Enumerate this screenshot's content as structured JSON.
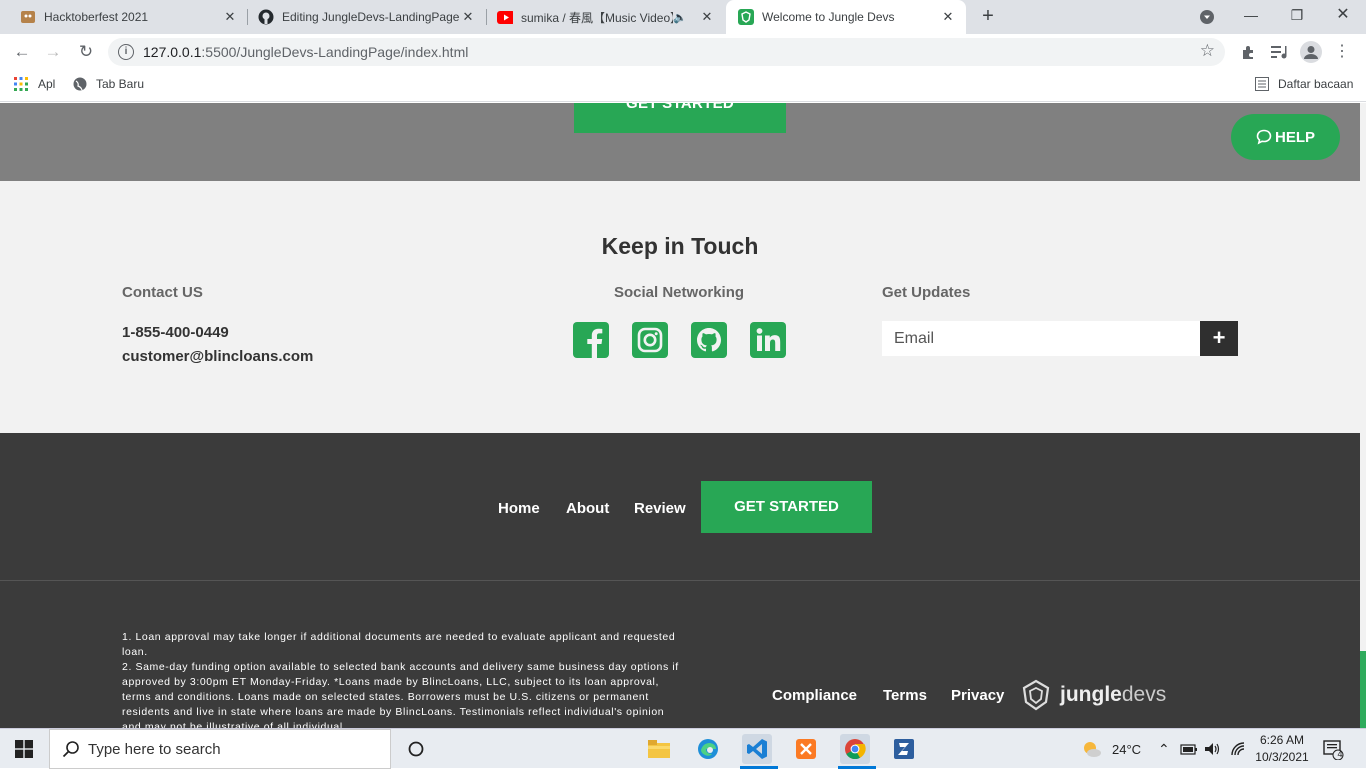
{
  "browser": {
    "tabs": [
      {
        "title": "Hacktoberfest 2021",
        "icon": "hacktoberfest-icon"
      },
      {
        "title": "Editing JungleDevs-LandingPage",
        "icon": "github-icon"
      },
      {
        "title": "sumika / 春風【Music Video】",
        "icon": "youtube-icon"
      },
      {
        "title": "Welcome to Jungle Devs",
        "icon": "jungledevs-icon"
      }
    ],
    "url_host": "127.0.0.1",
    "url_rest": ":5500/JungleDevs-LandingPage/index.html",
    "bookmarks": {
      "apps": "Apl",
      "new_tab": "Tab Baru",
      "reading_list": "Daftar bacaan"
    }
  },
  "hero": {
    "cta_label": "GET STARTED"
  },
  "help_button": {
    "label": "HELP"
  },
  "keep_in_touch": {
    "title": "Keep in Touch",
    "contact": {
      "heading": "Contact US",
      "phone": "1-855-400-0449",
      "email": "customer@blincloans.com"
    },
    "social": {
      "heading": "Social Networking",
      "icons": [
        "facebook-icon",
        "instagram-icon",
        "github-icon",
        "linkedin-icon"
      ]
    },
    "updates": {
      "heading": "Get Updates",
      "email_placeholder": "Email",
      "submit_label": "+"
    }
  },
  "footer": {
    "nav": [
      "Home",
      "About",
      "Review"
    ],
    "cta_label": "GET STARTED",
    "legal": [
      "1. Loan approval may take longer if additional documents are needed to evaluate applicant and requested loan.",
      "2. Same-day funding option available to selected bank accounts and delivery same business day options if approved by 3:00pm ET Monday-Friday. *Loans made by BlincLoans, LLC, subject to its loan approval, terms and conditions. Loans made on selected states. Borrowers must be U.S. citizens or permanent residents and live in state where loans are made by BlincLoans. Testimonials reflect individual's opinion and may not be illustrative of all individual"
    ],
    "links": [
      "Compliance",
      "Terms",
      "Privacy"
    ],
    "logo_bold": "jungle",
    "logo_light": "devs"
  },
  "taskbar": {
    "search_placeholder": "Type here to search",
    "temperature": "24°C",
    "time": "6:26 AM",
    "date": "10/3/2021",
    "notifications": "4"
  },
  "colors": {
    "accent": "#28a755",
    "footer_bg": "#3b3b3b",
    "hero_bg": "#808080",
    "section_bg": "#f2f2f2"
  }
}
